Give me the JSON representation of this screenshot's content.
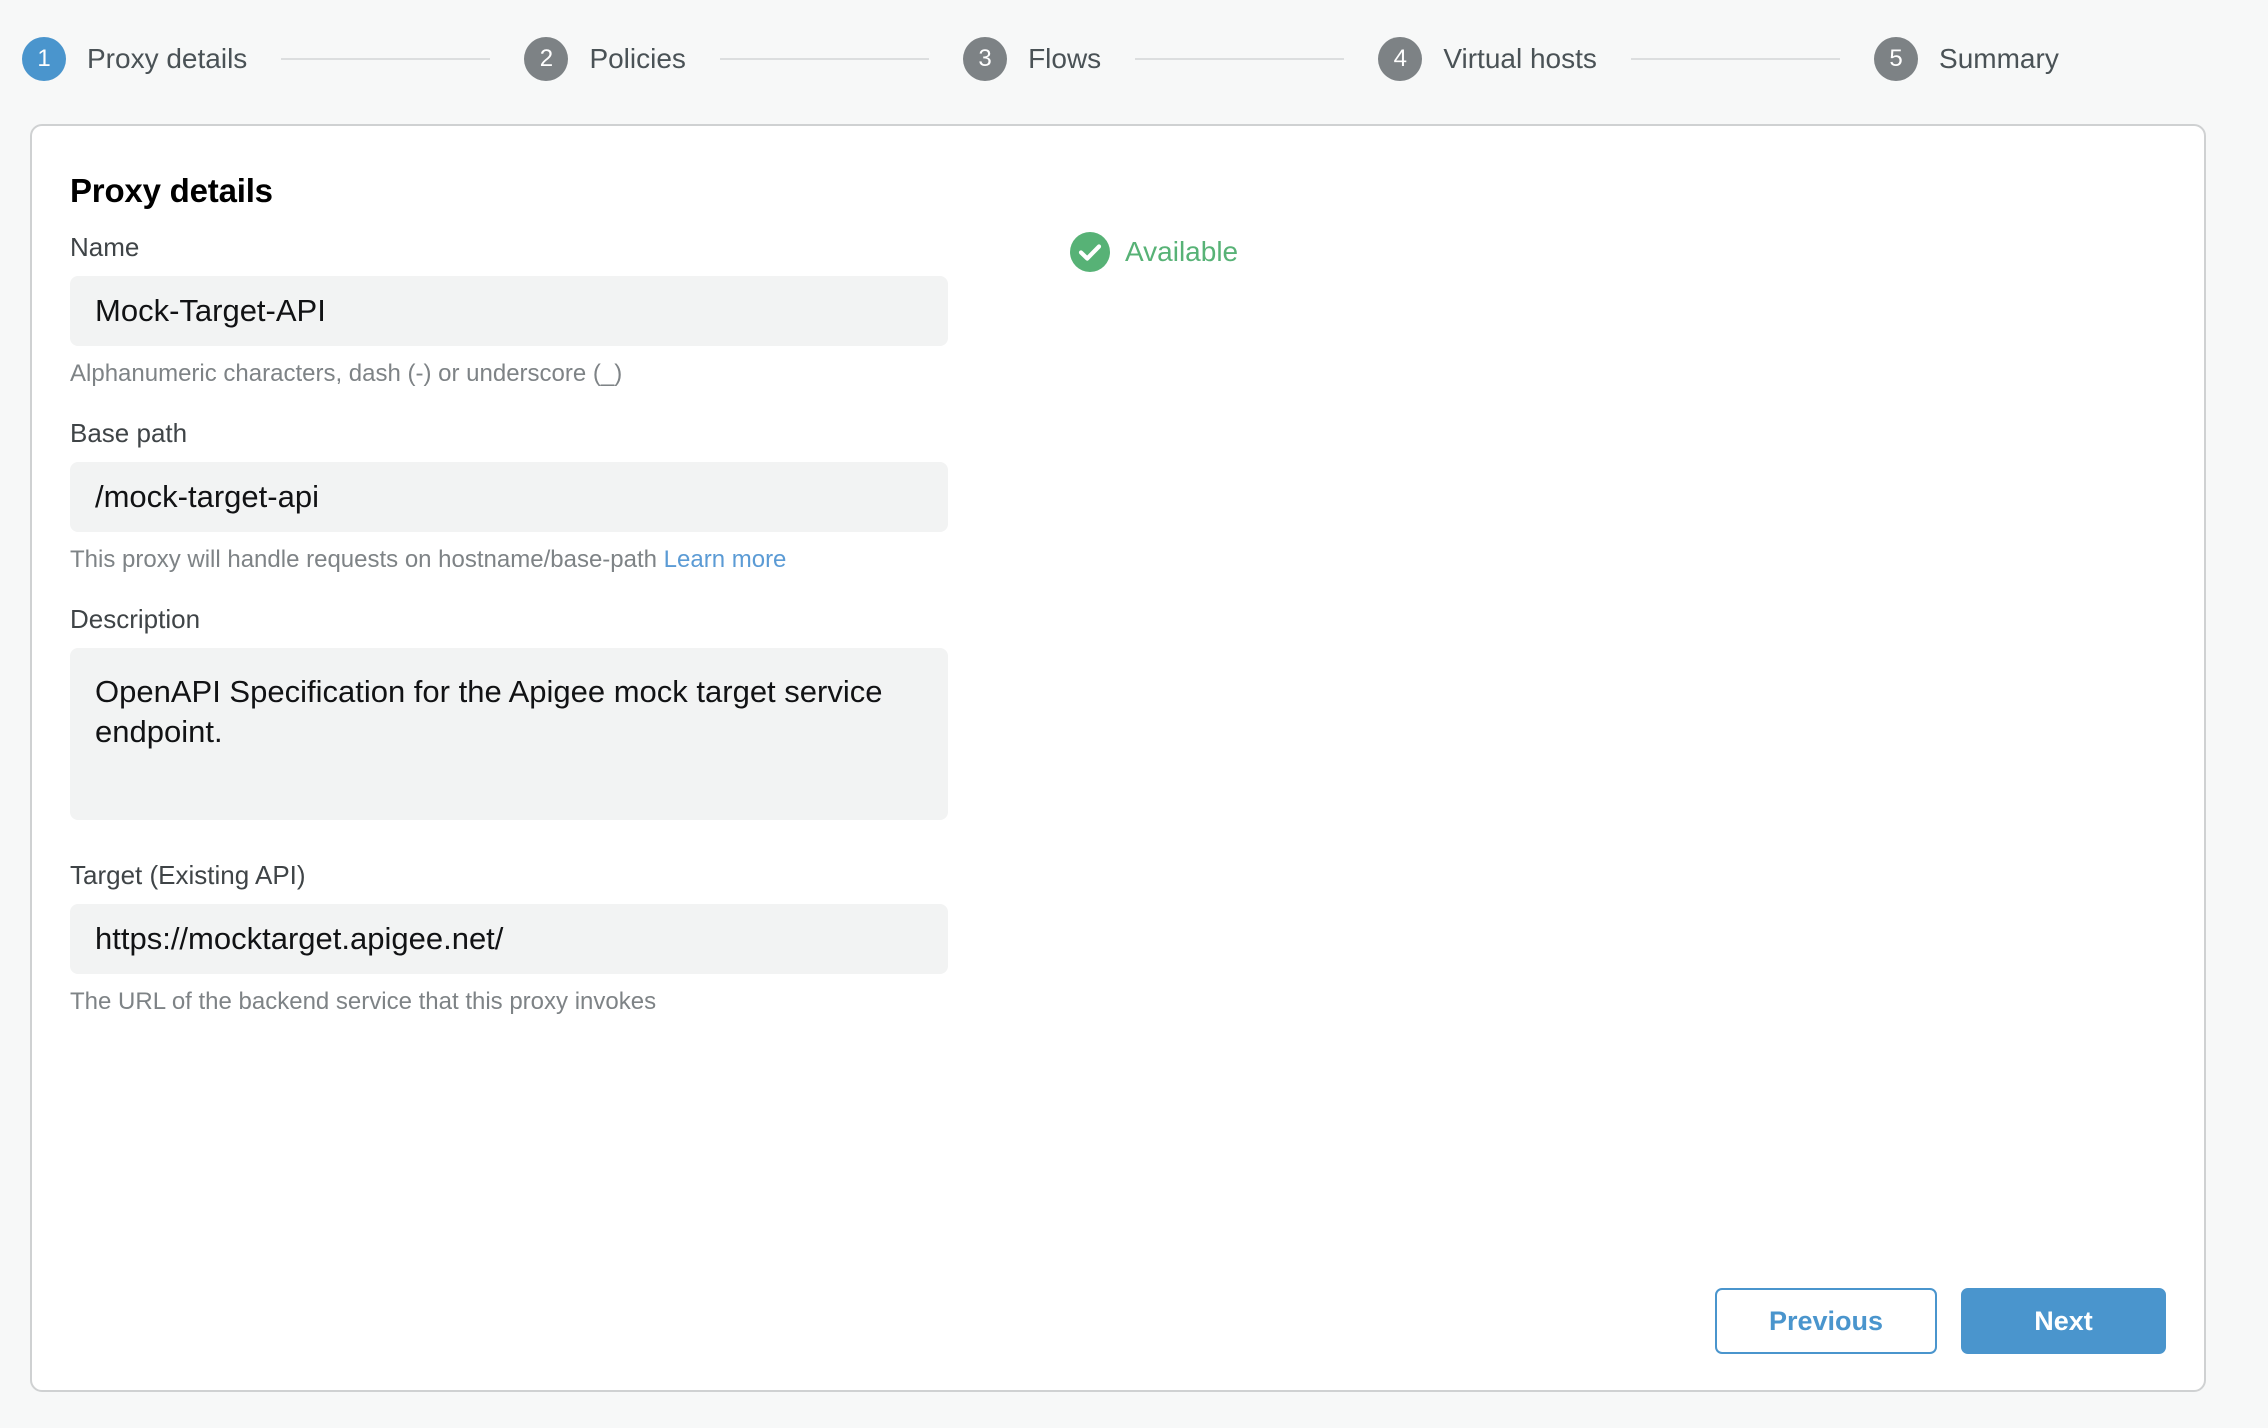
{
  "stepper": {
    "steps": [
      {
        "number": "1",
        "label": "Proxy details",
        "state": "active"
      },
      {
        "number": "2",
        "label": "Policies",
        "state": "inactive"
      },
      {
        "number": "3",
        "label": "Flows",
        "state": "inactive"
      },
      {
        "number": "4",
        "label": "Virtual hosts",
        "state": "inactive"
      },
      {
        "number": "5",
        "label": "Summary",
        "state": "inactive"
      }
    ]
  },
  "card": {
    "title": "Proxy details",
    "fields": {
      "name": {
        "label": "Name",
        "value": "Mock-Target-API",
        "help": "Alphanumeric characters, dash (-) or underscore (_)",
        "availability_text": "Available",
        "availability_icon": "check-circle-icon"
      },
      "base_path": {
        "label": "Base path",
        "value": "/mock-target-api",
        "help": "This proxy will handle requests on hostname/base-path",
        "help_link": "Learn more"
      },
      "description": {
        "label": "Description",
        "value": "OpenAPI Specification for the Apigee mock target service endpoint."
      },
      "target": {
        "label": "Target (Existing API)",
        "value": "https://mocktarget.apigee.net/",
        "help": "The URL of the backend service that this proxy invokes"
      }
    },
    "footer": {
      "previous_label": "Previous",
      "next_label": "Next"
    }
  },
  "colors": {
    "accent": "#4a95cd",
    "step_inactive": "#7d8285",
    "success": "#57b276",
    "page_background": "#f7f8f8",
    "input_background": "#f2f3f3",
    "link": "#5b9bd5"
  }
}
